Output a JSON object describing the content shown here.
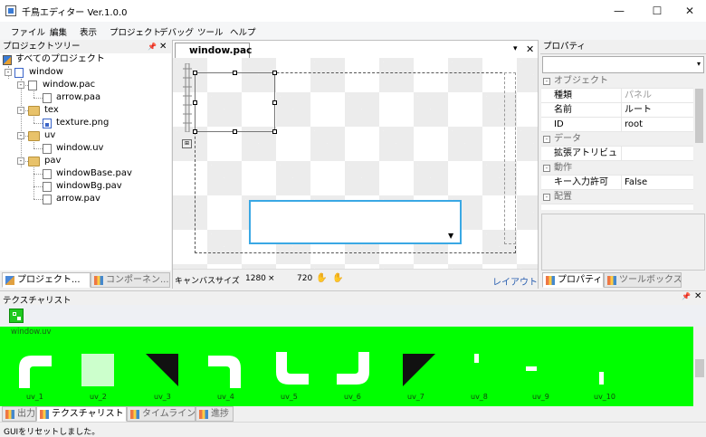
{
  "window": {
    "title": "千鳥エディター Ver.1.0.0",
    "minimize": "—",
    "maximize": "☐",
    "close": "✕"
  },
  "menu": [
    "ファイル",
    "編集",
    "表示",
    "プロジェクト",
    "デバッグ",
    "ツール",
    "ヘルプ"
  ],
  "project_tree": {
    "title": "プロジェクトツリー",
    "items": [
      {
        "label": "すべてのプロジェクト",
        "icon": "project-root-icon"
      },
      {
        "label": "window",
        "icon": "window-icon"
      },
      {
        "label": "window.pac",
        "icon": "file-icon"
      },
      {
        "label": "arrow.paa",
        "icon": "file-icon"
      },
      {
        "label": "tex",
        "icon": "folder-icon"
      },
      {
        "label": "texture.png",
        "icon": "image-file-icon"
      },
      {
        "label": "uv",
        "icon": "folder-icon"
      },
      {
        "label": "window.uv",
        "icon": "file-icon"
      },
      {
        "label": "pav",
        "icon": "folder-icon"
      },
      {
        "label": "windowBase.pav",
        "icon": "file-icon"
      },
      {
        "label": "windowBg.pav",
        "icon": "file-icon"
      },
      {
        "label": "arrow.pav",
        "icon": "file-icon"
      }
    ],
    "tabs": [
      "プロジェクト...",
      "コンポーネン..."
    ]
  },
  "document": {
    "tab": "window.pac",
    "canvas_size_label": "キャンバスサイズ",
    "canvas_width": "1280",
    "times": "×",
    "canvas_height": "720",
    "layout_link": "レイアウト"
  },
  "properties": {
    "title": "プロパティ",
    "rows": [
      {
        "type": "category",
        "name": "オブジェクト"
      },
      {
        "type": "prop",
        "name": "種類",
        "value": "パネル",
        "readonly": true
      },
      {
        "type": "prop",
        "name": "名前",
        "value": "ルート"
      },
      {
        "type": "prop",
        "name": "ID",
        "value": "root"
      },
      {
        "type": "category",
        "name": "データ"
      },
      {
        "type": "prop",
        "name": "拡張アトリビュ",
        "value": ""
      },
      {
        "type": "category",
        "name": "動作"
      },
      {
        "type": "prop",
        "name": "キー入力許可",
        "value": "False"
      },
      {
        "type": "category",
        "name": "配置"
      }
    ],
    "tabs": [
      "プロパティ",
      "ツールボックス"
    ]
  },
  "texture_list": {
    "title": "テクスチャリスト",
    "source": "window.uv",
    "items": [
      "uv_1",
      "uv_2",
      "uv_3",
      "uv_4",
      "uv_5",
      "uv_6",
      "uv_7",
      "uv_8",
      "uv_9",
      "uv_10"
    ],
    "bg_color": "#00ff00"
  },
  "bottom_tabs": [
    "出力",
    "テクスチャリスト",
    "タイムライン",
    "進捗"
  ],
  "status": "GUIをリセットしました。"
}
